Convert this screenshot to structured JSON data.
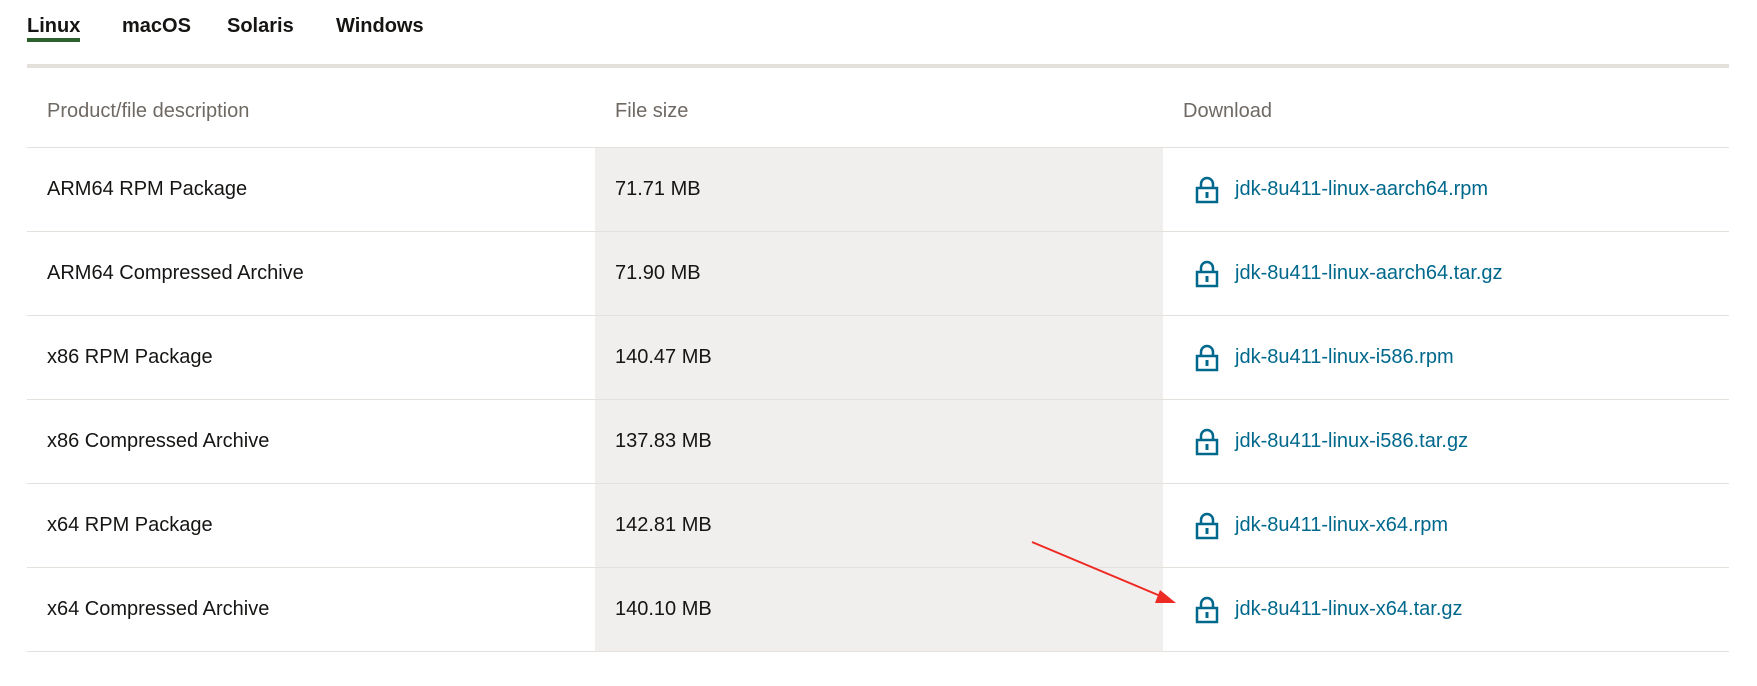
{
  "tabs": [
    {
      "label": "Linux",
      "active": true
    },
    {
      "label": "macOS",
      "active": false
    },
    {
      "label": "Solaris",
      "active": false
    },
    {
      "label": "Windows",
      "active": false
    }
  ],
  "table": {
    "headers": {
      "description": "Product/file description",
      "size": "File size",
      "download": "Download"
    },
    "rows": [
      {
        "description": "ARM64 RPM Package",
        "size": "71.71 MB",
        "file": "jdk-8u411-linux-aarch64.rpm"
      },
      {
        "description": "ARM64 Compressed Archive",
        "size": "71.90 MB",
        "file": "jdk-8u411-linux-aarch64.tar.gz"
      },
      {
        "description": "x86 RPM Package",
        "size": "140.47 MB",
        "file": "jdk-8u411-linux-i586.rpm"
      },
      {
        "description": "x86 Compressed Archive",
        "size": "137.83 MB",
        "file": "jdk-8u411-linux-i586.tar.gz"
      },
      {
        "description": "x64 RPM Package",
        "size": "142.81 MB",
        "file": "jdk-8u411-linux-x64.rpm"
      },
      {
        "description": "x64 Compressed Archive",
        "size": "140.10 MB",
        "file": "jdk-8u411-linux-x64.tar.gz"
      }
    ]
  },
  "icons": {
    "download_lock": "lock-icon",
    "annotation": "red-arrow-icon"
  },
  "colors": {
    "active_tab_underline": "#2e5f2f",
    "link": "#00688c",
    "size_column_bg": "#f1efed",
    "annotation_arrow": "#ee2a24"
  }
}
